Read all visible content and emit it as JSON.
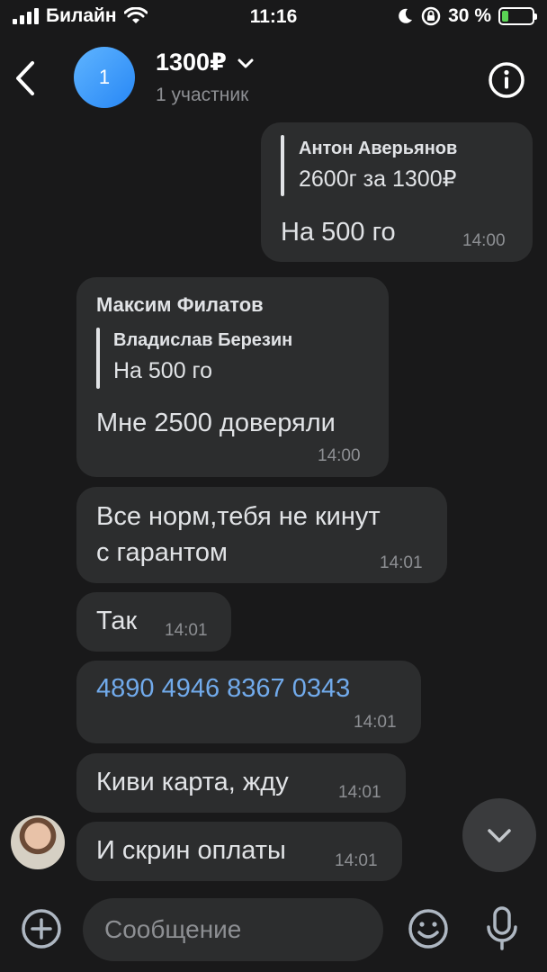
{
  "status_bar": {
    "carrier": "Билайн",
    "time": "11:16",
    "battery": "30 %",
    "battery_level": 0.3
  },
  "header": {
    "avatar_text": "1",
    "title": "1300₽",
    "subtitle": "1 участник"
  },
  "messages": [
    {
      "reply_name": "Антон Аверьянов",
      "reply_text": "2600г за 1300₽",
      "text": "На 500 го",
      "time": "14:00",
      "outgoing": true
    },
    {
      "sender": "Максим Филатов",
      "reply_name": "Владислав Березин",
      "reply_text": "На 500 го",
      "text": "Мне 2500 доверяли",
      "time": "14:00"
    },
    {
      "text_line1": "Все норм,тебя не кинут",
      "text_line2": "с гарантом",
      "time": "14:01"
    },
    {
      "text": "Так",
      "time": "14:01"
    },
    {
      "text": "4890 4946 8367 0343",
      "time": "14:01",
      "is_link": true
    },
    {
      "text": "Киви карта, жду",
      "time": "14:01"
    },
    {
      "text": "И скрин оплаты",
      "time": "14:01"
    }
  ],
  "composer": {
    "placeholder": "Сообщение"
  },
  "colors": {
    "background": "#19191a",
    "bubble": "#2c2d2e",
    "link": "#71aaeb",
    "accent": "#2787f5"
  }
}
